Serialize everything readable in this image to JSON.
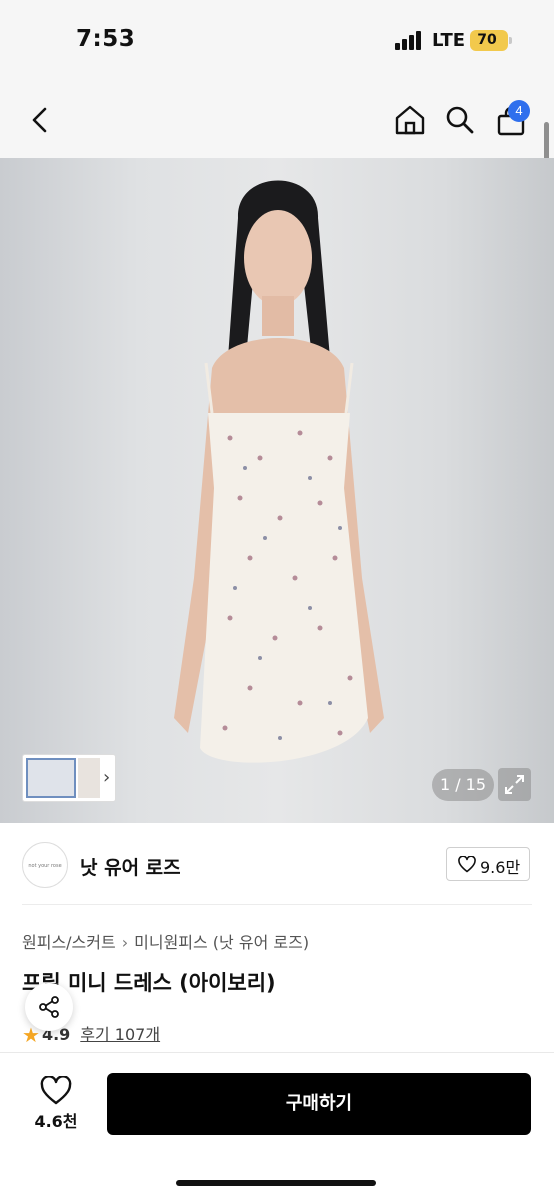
{
  "status_bar": {
    "time": "7:53",
    "network": "LTE",
    "battery": "70"
  },
  "header": {
    "back_icon": "chevron-left-icon",
    "home_icon": "home-icon",
    "search_icon": "search-icon",
    "cart_icon": "shopping-bag-icon",
    "cart_badge": "4"
  },
  "gallery": {
    "counter": "1 / 15",
    "expand_icon": "expand-icon",
    "thumbnail_arrow": "›"
  },
  "brand": {
    "logo_text": "not your rose",
    "name": "낫 유어 로즈",
    "likes": "9.6만"
  },
  "product": {
    "breadcrumb": [
      "원피스/스커트",
      "미니원피스 (낫 유어 로즈)"
    ],
    "title": "프릴 미니 드레스 (아이보리)",
    "rating": "4.9",
    "reviews": "후기 107개"
  },
  "bottom_bar": {
    "wish_count": "4.6천",
    "buy_label": "구매하기"
  },
  "colors": {
    "accent_badge": "#2f6fed",
    "buy_button": "#000000",
    "star": "#f5a623"
  }
}
